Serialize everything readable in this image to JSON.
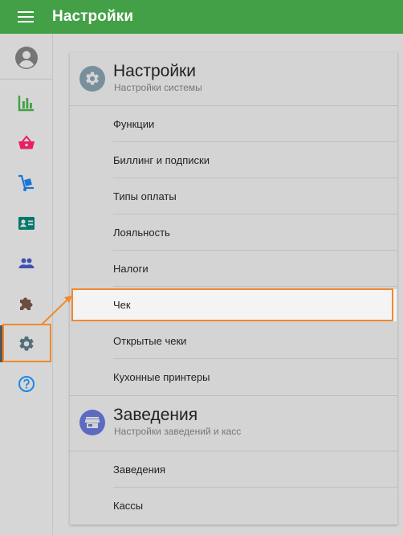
{
  "header": {
    "title": "Настройки"
  },
  "sidebar": {
    "items": [
      {
        "name": "reports",
        "icon": "bar-chart-icon",
        "color": "#43a047"
      },
      {
        "name": "items",
        "icon": "basket-icon",
        "color": "#e91e63"
      },
      {
        "name": "inventory",
        "icon": "dolly-icon",
        "color": "#1976d2"
      },
      {
        "name": "customers",
        "icon": "id-card-icon",
        "color": "#00796b"
      },
      {
        "name": "employees",
        "icon": "people-icon",
        "color": "#3f51b5"
      },
      {
        "name": "integrations",
        "icon": "puzzle-icon",
        "color": "#6d4c41"
      },
      {
        "name": "settings",
        "icon": "gear-icon",
        "color": "#546e7a",
        "active": true
      },
      {
        "name": "help",
        "icon": "help-icon",
        "color": "#1e88e5"
      }
    ]
  },
  "settings_section": {
    "title": "Настройки",
    "subtitle": "Настройки системы",
    "icon_color": "#78909c",
    "items": [
      {
        "label": "Функции"
      },
      {
        "label": "Биллинг и подписки"
      },
      {
        "label": "Типы оплаты"
      },
      {
        "label": "Лояльность"
      },
      {
        "label": "Налоги"
      },
      {
        "label": "Чек",
        "selected": true
      },
      {
        "label": "Открытые чеки"
      },
      {
        "label": "Кухонные принтеры"
      }
    ]
  },
  "stores_section": {
    "title": "Заведения",
    "subtitle": "Настройки заведений и касс",
    "icon_color": "#5c6bc0",
    "items": [
      {
        "label": "Заведения"
      },
      {
        "label": "Кассы"
      }
    ]
  },
  "annotation_color": "#f0892e"
}
